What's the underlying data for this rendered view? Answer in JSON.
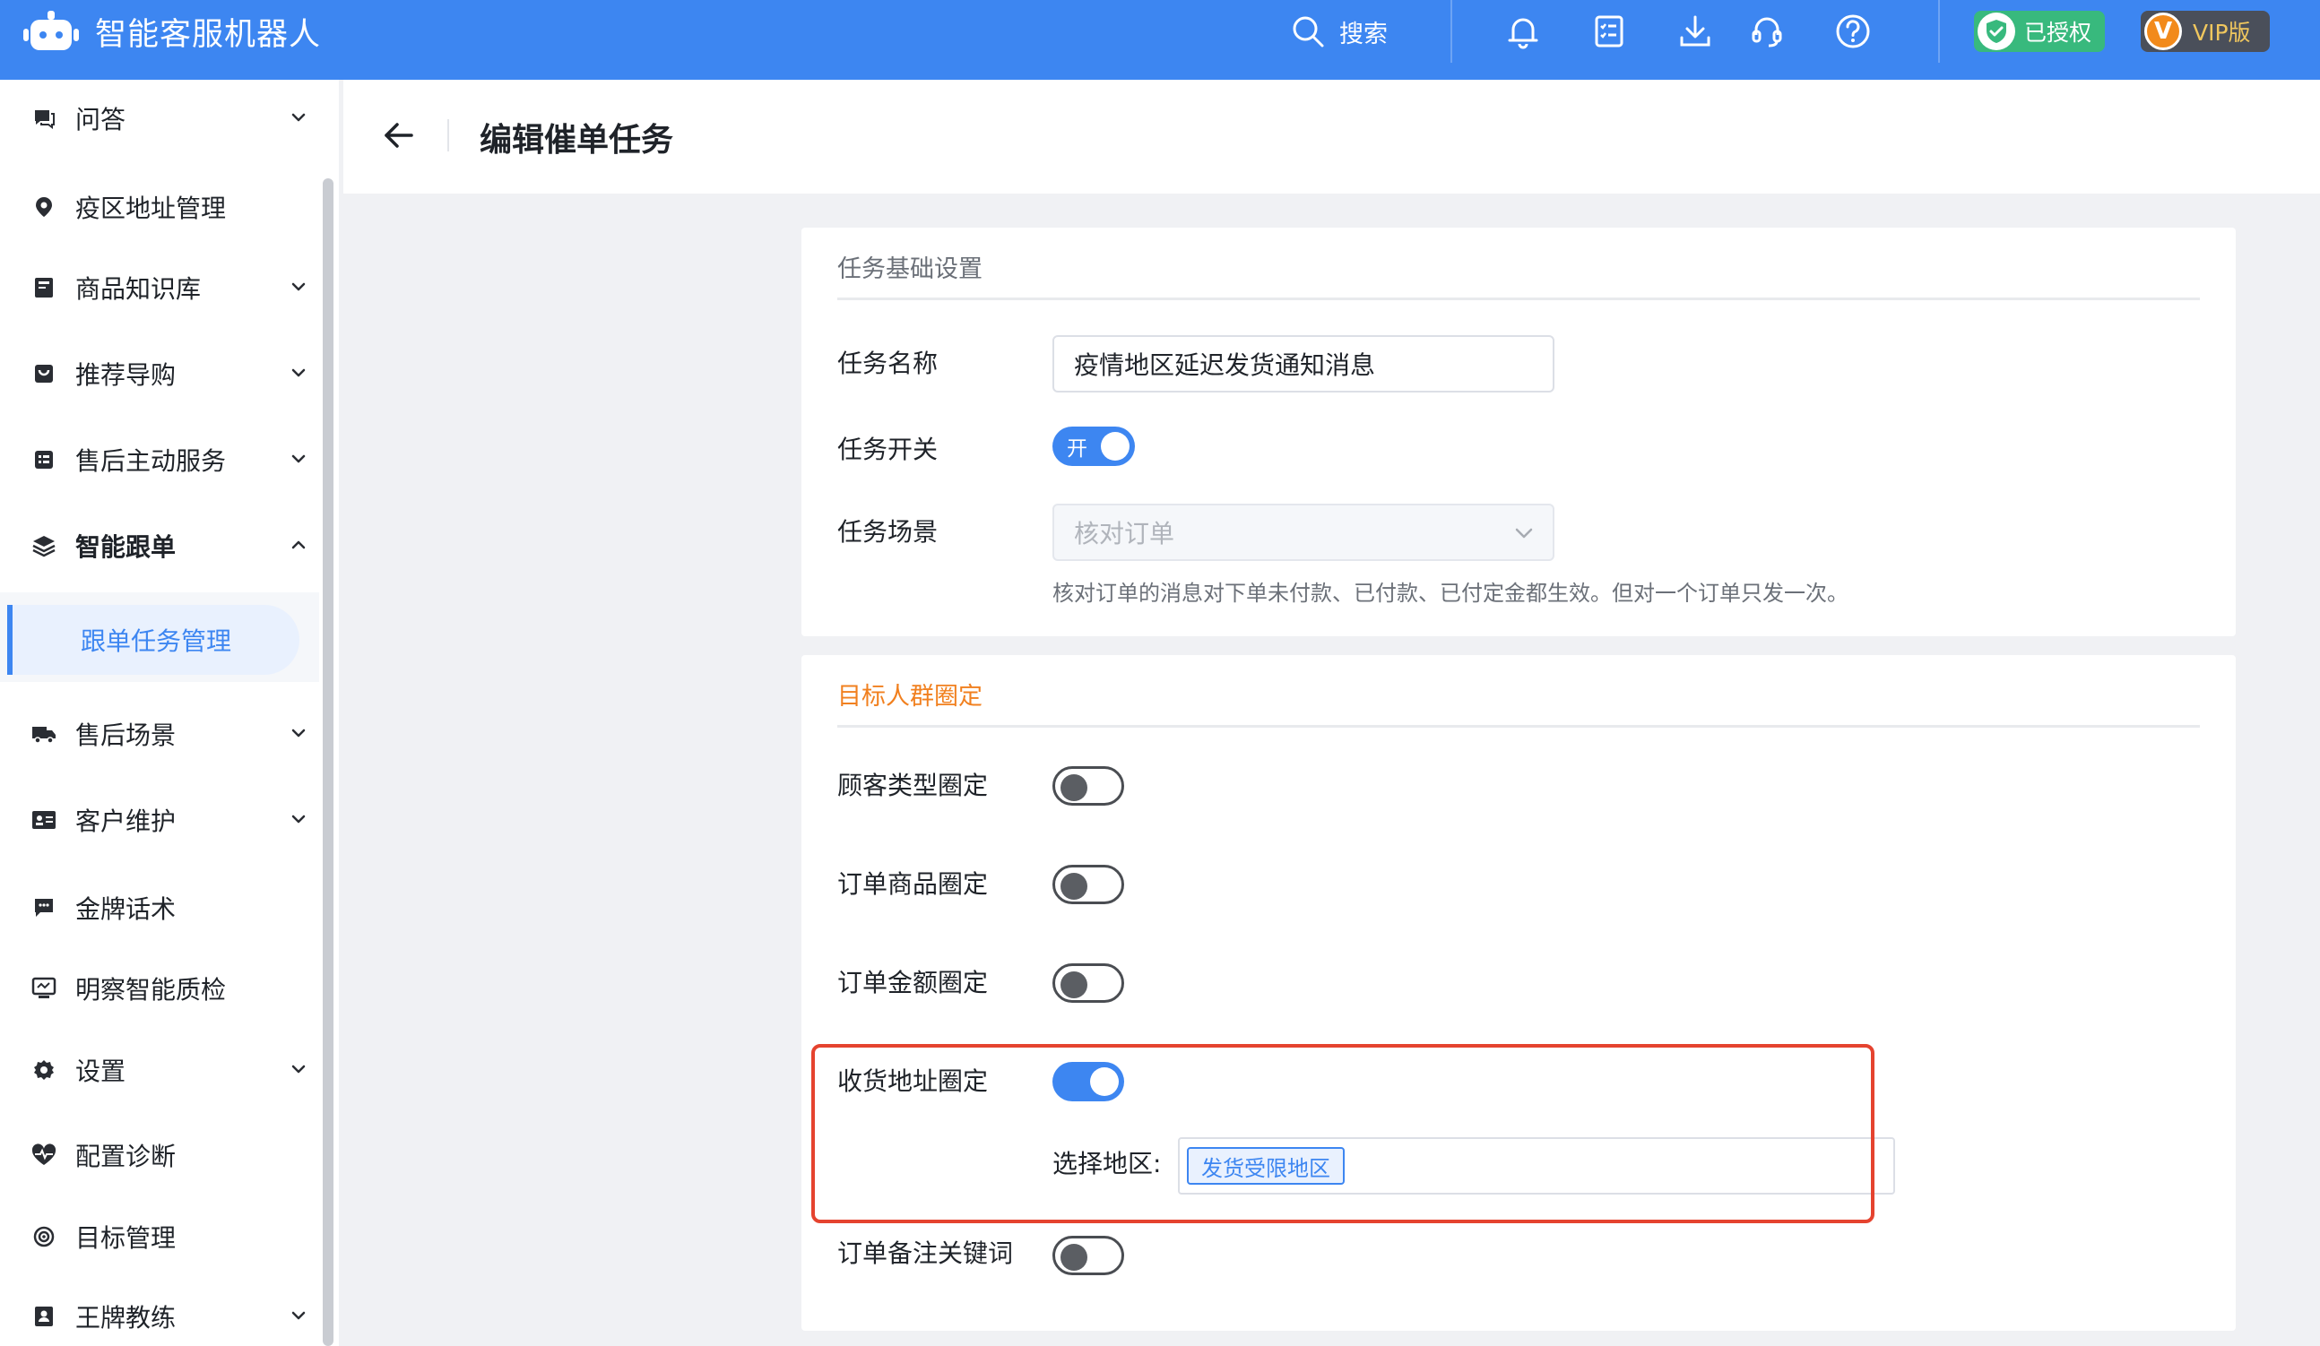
{
  "app": {
    "title": "智能客服机器人"
  },
  "topbar": {
    "search_label": "搜索",
    "auth_label": "已授权",
    "vip_label": "VIP版",
    "vip_glyph": "V",
    "icons": [
      "bell-icon",
      "checklist-icon",
      "download-icon",
      "headset-icon",
      "help-icon"
    ]
  },
  "sidebar": {
    "items": [
      {
        "label": "问答",
        "icon": "chat-icon",
        "has_chevron": true
      },
      {
        "label": "疫区地址管理",
        "icon": "location-icon",
        "has_chevron": false
      },
      {
        "label": "商品知识库",
        "icon": "book-icon",
        "has_chevron": true
      },
      {
        "label": "推荐导购",
        "icon": "bag-icon",
        "has_chevron": true
      },
      {
        "label": "售后主动服务",
        "icon": "list-icon",
        "has_chevron": true
      },
      {
        "label": "智能跟单",
        "icon": "layers-icon",
        "has_chevron": true,
        "expanded": true
      },
      {
        "label": "售后场景",
        "icon": "truck-icon",
        "has_chevron": true
      },
      {
        "label": "客户维护",
        "icon": "card-icon",
        "has_chevron": true
      },
      {
        "label": "金牌话术",
        "icon": "message-icon",
        "has_chevron": false
      },
      {
        "label": "明察智能质检",
        "icon": "monitor-icon",
        "has_chevron": false
      },
      {
        "label": "设置",
        "icon": "gear-icon",
        "has_chevron": true
      },
      {
        "label": "配置诊断",
        "icon": "pulse-icon",
        "has_chevron": false
      },
      {
        "label": "目标管理",
        "icon": "target-icon",
        "has_chevron": false
      },
      {
        "label": "王牌教练",
        "icon": "user-card-icon",
        "has_chevron": true
      }
    ],
    "active_sub": "跟单任务管理"
  },
  "page": {
    "title": "编辑催单任务"
  },
  "basic": {
    "section_title": "任务基础设置",
    "name_label": "任务名称",
    "name_value": "疫情地区延迟发货通知消息",
    "switch_label": "任务开关",
    "switch_on_text": "开",
    "switch_on": true,
    "scene_label": "任务场景",
    "scene_value": "核对订单",
    "scene_hint": "核对订单的消息对下单未付款、已付款、已付定金都生效。但对一个订单只发一次。"
  },
  "target": {
    "section_title": "目标人群圈定",
    "rows": [
      {
        "label": "顾客类型圈定",
        "on": false
      },
      {
        "label": "订单商品圈定",
        "on": false
      },
      {
        "label": "订单金额圈定",
        "on": false
      },
      {
        "label": "收货地址圈定",
        "on": true
      },
      {
        "label": "订单备注关键词",
        "on": false
      }
    ],
    "region_label": "选择地区:",
    "region_tag": "发货受限地区"
  },
  "colors": {
    "primary": "#3d86f1",
    "auth_green": "#38b97d",
    "vip_orange": "#f28a1b",
    "section_orange": "#f1801f",
    "highlight_red": "#e5432f"
  }
}
